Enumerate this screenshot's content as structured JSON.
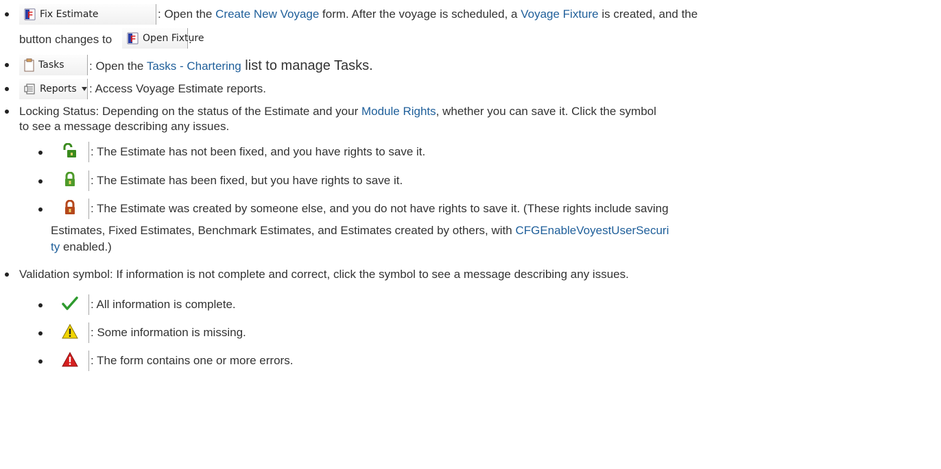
{
  "fix_estimate": {
    "button_label": "Fix Estimate",
    "text_1": ": Open the ",
    "link_create_voyage": "Create New Voyage",
    "text_2": " form. After the voyage is scheduled, a ",
    "link_voyage_fixture": "Voyage Fixture",
    "text_3": " is created, and the",
    "text_4": "button changes to",
    "open_fixture_label": "Open Fixture",
    "text_5": "."
  },
  "tasks": {
    "button_label": "Tasks",
    "text_1": ": Open the ",
    "link_tasks": "Tasks - Chartering",
    "text_2": " list to manage Tasks."
  },
  "reports": {
    "button_label": "Reports",
    "text_1": ": Access Voyage Estimate reports."
  },
  "locking": {
    "text_1": "Locking Status: Depending on the status of the Estimate and your ",
    "link_module_rights": "Module Rights",
    "text_2": ", whether you can save it. Click the symbol",
    "text_3": "to see a message describing any issues.",
    "unlocked_text": ": The Estimate has not been fixed, and you have rights to save it.",
    "fixed_text": ": The Estimate has been fixed, but you have rights to save it.",
    "locked_text_1": ": The Estimate was created by someone else, and you do not have rights to save it. (These rights include saving",
    "locked_text_2": "Estimates, Fixed Estimates, Benchmark Estimates, and Estimates created by others, with ",
    "link_cfg_a": "CFGEnableVoyestUserSecuri",
    "link_cfg_b": "ty",
    "locked_text_3": " enabled.)"
  },
  "validation": {
    "text_1": "Validation symbol: If information is not complete and correct, click the symbol to see a message describing any issues.",
    "complete_text": ": All information is complete.",
    "missing_text": ": Some information is missing.",
    "error_text": ": The form contains one or more errors."
  },
  "colors": {
    "link": "#1f5f9a",
    "lock_open": "#3a8a1e",
    "lock_fixed": "#4d9a2a",
    "lock_locked": "#b5481c",
    "check": "#2e9a2e",
    "warning": "#f2d600",
    "error": "#d62020"
  },
  "icons": [
    "fix-estimate-icon",
    "open-fixture-icon",
    "clipboard-icon",
    "reports-icon",
    "dropdown-arrow-icon",
    "lock-open-icon",
    "lock-fixed-icon",
    "lock-locked-icon",
    "checkmark-icon",
    "warning-icon",
    "error-icon"
  ]
}
